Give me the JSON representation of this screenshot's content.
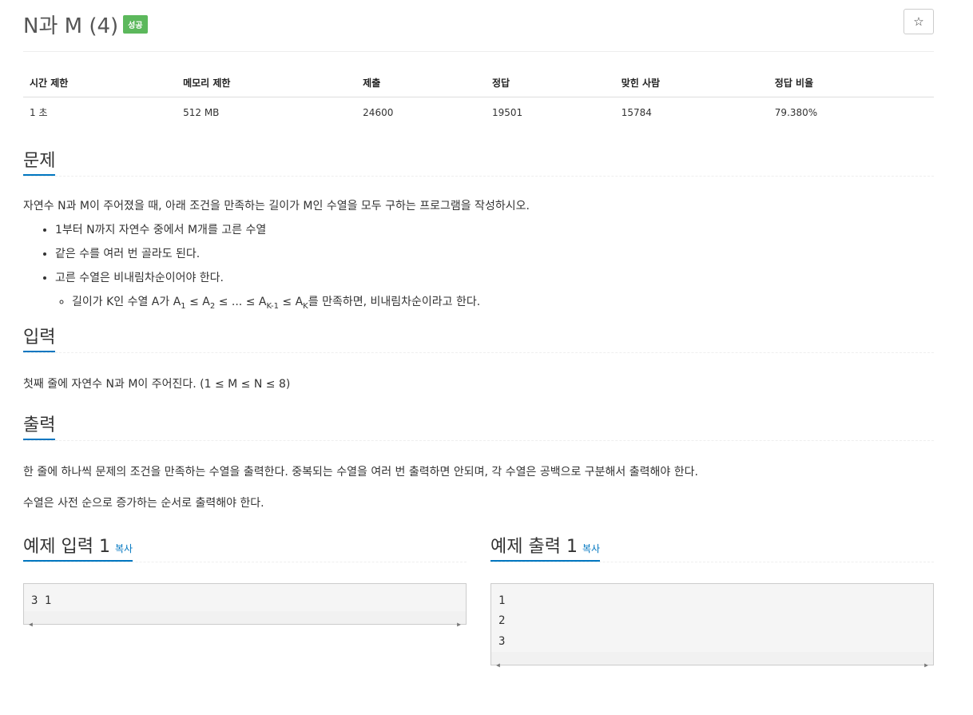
{
  "problem": {
    "title": "N과 M (4)",
    "badge": "성공",
    "star": "☆"
  },
  "stats": {
    "headers": [
      "시간 제한",
      "메모리 제한",
      "제출",
      "정답",
      "맞힌 사람",
      "정답 비율"
    ],
    "values": [
      "1 초",
      "512 MB",
      "24600",
      "19501",
      "15784",
      "79.380%"
    ]
  },
  "sections": {
    "problem": {
      "heading": "문제",
      "intro": "자연수 N과 M이 주어졌을 때, 아래 조건을 만족하는 길이가 M인 수열을 모두 구하는 프로그램을 작성하시오.",
      "rules": [
        "1부터 N까지 자연수 중에서 M개를 고른 수열",
        "같은 수를 여러 번 골라도 된다.",
        "고른 수열은 비내림차순이어야 한다."
      ],
      "subrule": {
        "prefix": "길이가 K인 수열 A가 A",
        "sub1": "1",
        "part2": " ≤ A",
        "sub2": "2",
        "part3": " ≤ ... ≤ A",
        "sub3": "K-1",
        "part4": " ≤ A",
        "sub4": "K",
        "suffix": "를 만족하면, 비내림차순이라고 한다."
      }
    },
    "input": {
      "heading": "입력",
      "text": "첫째 줄에 자연수 N과 M이 주어진다. (1 ≤ M ≤ N ≤ 8)"
    },
    "output": {
      "heading": "출력",
      "text1": "한 줄에 하나씩 문제의 조건을 만족하는 수열을 출력한다. 중복되는 수열을 여러 번 출력하면 안되며, 각 수열은 공백으로 구분해서 출력해야 한다.",
      "text2": "수열은 사전 순으로 증가하는 순서로 출력해야 한다."
    }
  },
  "samples": {
    "input": {
      "heading": "예제 입력 1",
      "copy": "복사",
      "content": "3 1"
    },
    "output": {
      "heading": "예제 출력 1",
      "copy": "복사",
      "content": "1\n2\n3"
    }
  }
}
